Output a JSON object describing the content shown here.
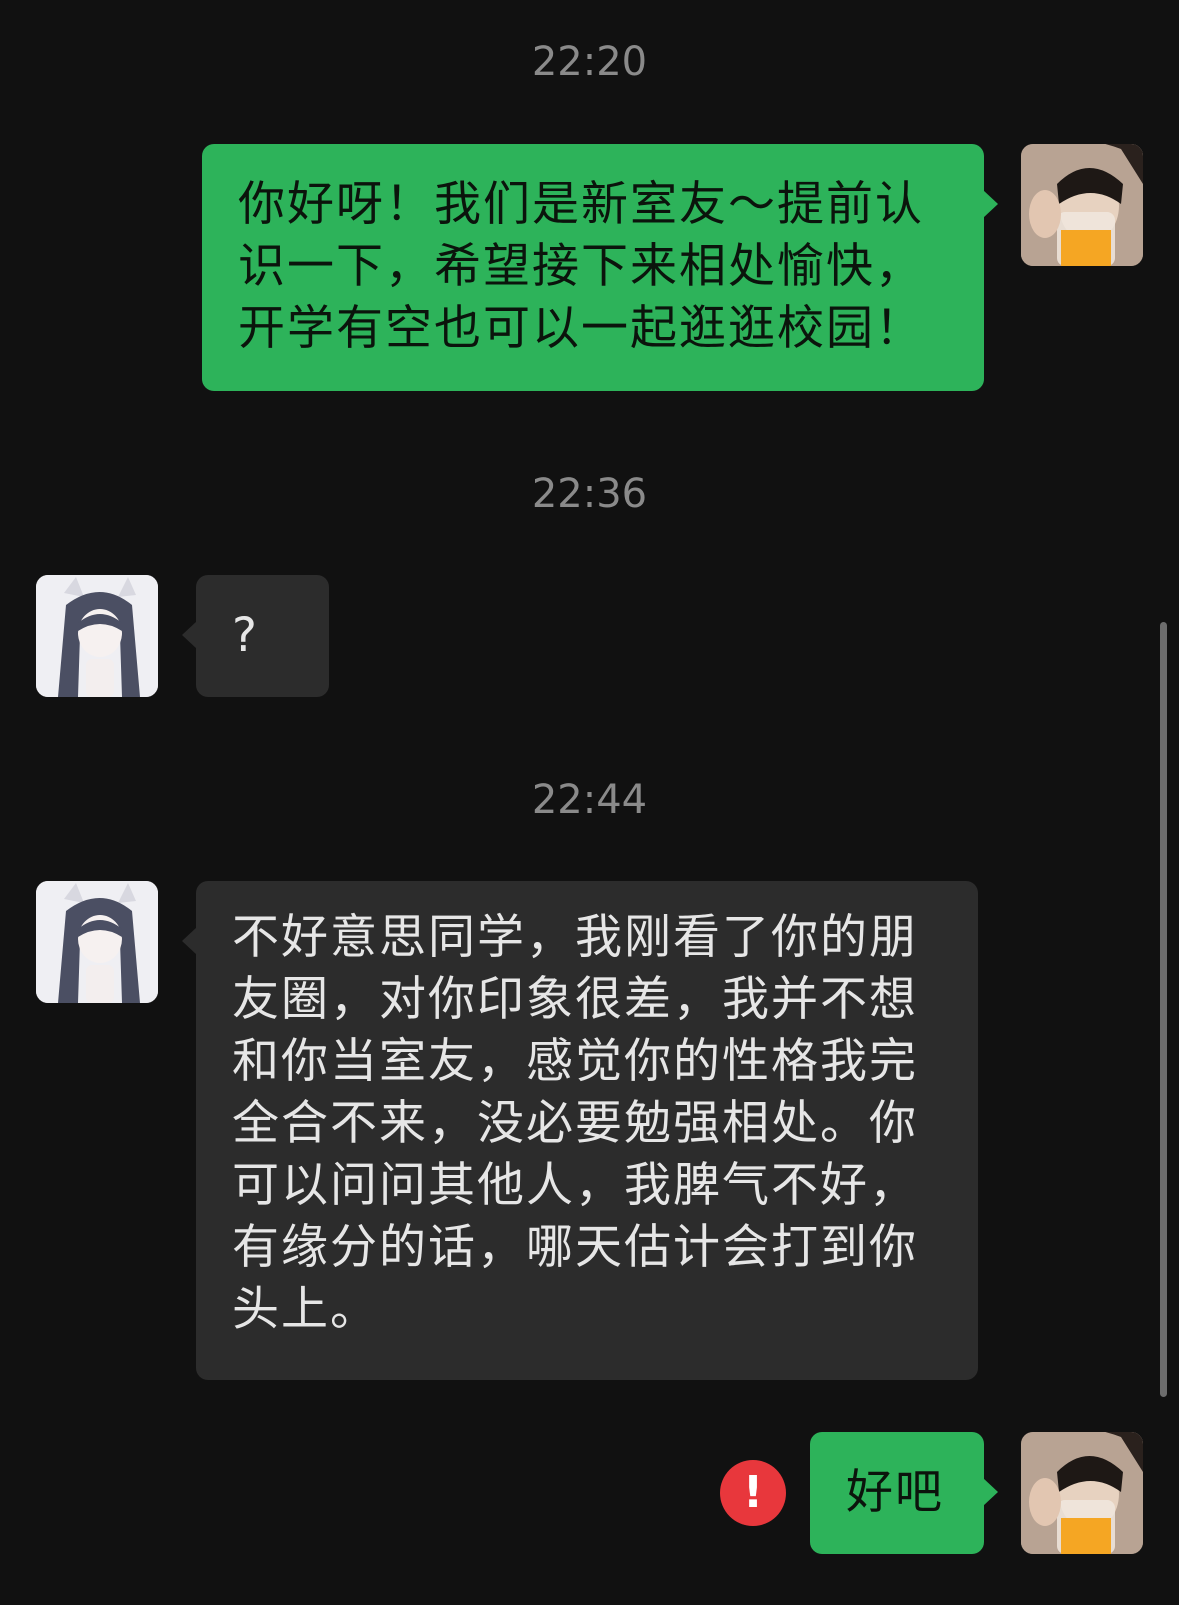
{
  "timestamps": [
    "22:20",
    "22:36",
    "22:44"
  ],
  "messages": [
    {
      "side": "right",
      "text": "你好呀！我们是新室友～提前认识一下，希望接下来相处愉快，开学有空也可以一起逛逛校园！"
    },
    {
      "side": "left",
      "text": "?"
    },
    {
      "side": "left",
      "text": "不好意思同学，我刚看了你的朋友圈，对你印象很差，我并不想和你当室友，感觉你的性格我完全合不来，没必要勉强相处。你可以问问其他人，我脾气不好，有缘分的话，哪天估计会打到你头上。"
    },
    {
      "side": "right",
      "text": "好吧",
      "failed": true
    }
  ],
  "error_badge": {
    "glyph": "!",
    "color": "#e8373c"
  },
  "colors": {
    "background": "#111111",
    "outgoing_bubble": "#2db35a",
    "incoming_bubble": "#2c2c2c",
    "timestamp": "#8a8a8a"
  }
}
